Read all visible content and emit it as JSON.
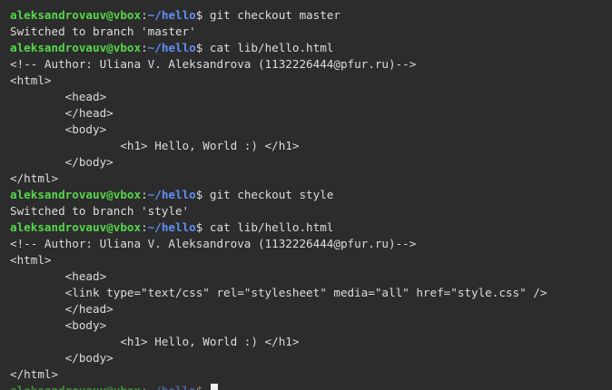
{
  "prompt": {
    "user_host": "aleksandrovauv@vbox",
    "separator": ":",
    "path": "~/hello",
    "symbol": "$ "
  },
  "lines": [
    {
      "kind": "prompt",
      "cmd": "git checkout master"
    },
    {
      "kind": "out",
      "text": "Switched to branch 'master'"
    },
    {
      "kind": "prompt",
      "cmd": "cat lib/hello.html"
    },
    {
      "kind": "out",
      "text": "<!-- Author: Uliana V. Aleksandrova (1132226444@pfur.ru)-->"
    },
    {
      "kind": "out",
      "text": "<html>"
    },
    {
      "kind": "out",
      "text": "        <head>"
    },
    {
      "kind": "out",
      "text": "        </head>"
    },
    {
      "kind": "out",
      "text": "        <body>"
    },
    {
      "kind": "out",
      "text": "                <h1> Hello, World :) </h1>"
    },
    {
      "kind": "out",
      "text": "        </body>"
    },
    {
      "kind": "out",
      "text": "</html>"
    },
    {
      "kind": "prompt",
      "cmd": "git checkout style"
    },
    {
      "kind": "out",
      "text": "Switched to branch 'style'"
    },
    {
      "kind": "prompt",
      "cmd": "cat lib/hello.html"
    },
    {
      "kind": "out",
      "text": "<!-- Author: Uliana V. Aleksandrova (1132226444@pfur.ru)-->"
    },
    {
      "kind": "out",
      "text": "<html>"
    },
    {
      "kind": "out",
      "text": "        <head>"
    },
    {
      "kind": "out",
      "text": "        <link type=\"text/css\" rel=\"stylesheet\" media=\"all\" href=\"style.css\" />"
    },
    {
      "kind": "out",
      "text": "        </head>"
    },
    {
      "kind": "out",
      "text": "        <body>"
    },
    {
      "kind": "out",
      "text": "                <h1> Hello, World :) </h1>"
    },
    {
      "kind": "out",
      "text": "        </body>"
    },
    {
      "kind": "out",
      "text": "</html>"
    },
    {
      "kind": "prompt",
      "cmd": "",
      "cursor": true
    }
  ],
  "colors": {
    "background": "#2c2c2c",
    "user_host": "#55d84a",
    "path": "#5f8ff7",
    "text": "#dcdcdc",
    "cursor": "#f2f2f2"
  }
}
